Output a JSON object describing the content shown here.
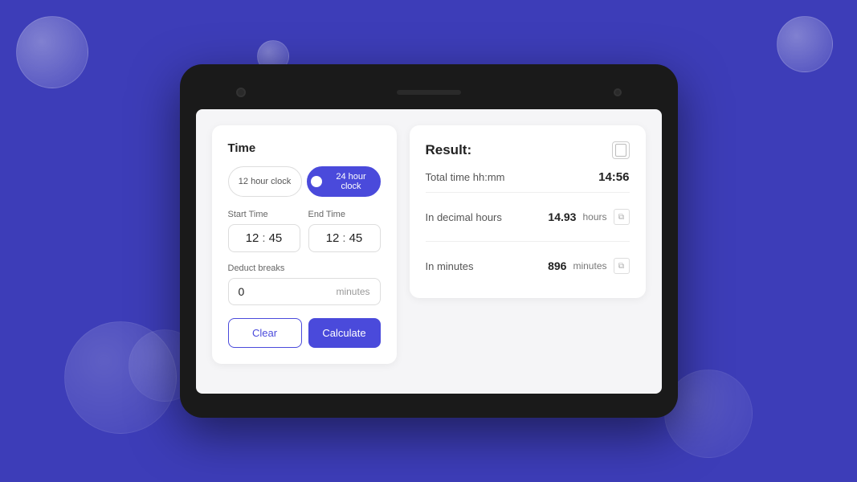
{
  "background": {
    "color": "#3d3db8"
  },
  "tablet": {
    "left_panel": {
      "title": "Time",
      "clock_options": {
        "twelve_hour": "12 hour clock",
        "twenty_four_hour": "24 hour clock",
        "active": "twenty_four_hour"
      },
      "start_time": {
        "label": "Start Time",
        "hours": "12",
        "minutes": "45"
      },
      "end_time": {
        "label": "End Time",
        "hours": "12",
        "minutes": "45"
      },
      "deduct_breaks": {
        "label": "Deduct breaks",
        "value": "0",
        "unit": "minutes"
      },
      "buttons": {
        "clear": "Clear",
        "calculate": "Calculate"
      }
    },
    "right_panel": {
      "title": "Result:",
      "total_time": {
        "label": "Total time hh:mm",
        "value": "14:56"
      },
      "decimal_hours": {
        "label": "In decimal hours",
        "value": "14.93",
        "unit": "hours"
      },
      "minutes": {
        "label": "In minutes",
        "value": "896",
        "unit": "minutes"
      }
    }
  }
}
